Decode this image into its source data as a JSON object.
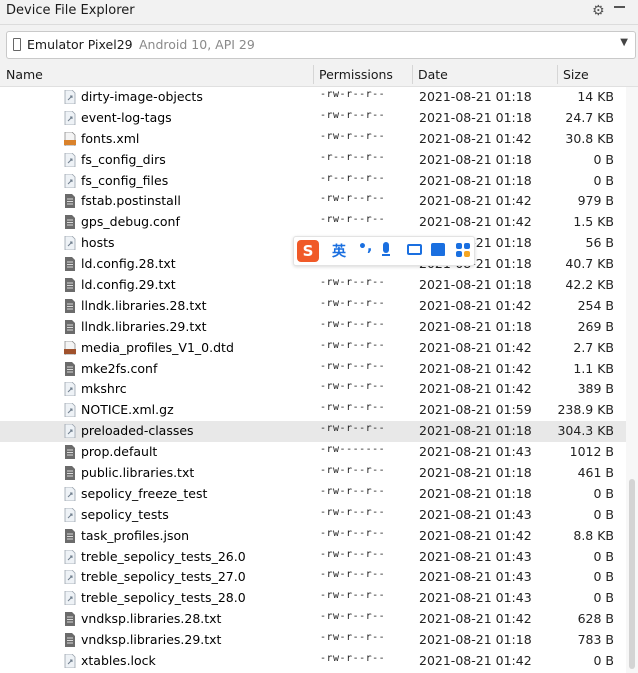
{
  "window": {
    "title": "Device File Explorer",
    "settings_icon": "gear-icon",
    "minimize_icon": "minimize-icon"
  },
  "device": {
    "name": "Emulator Pixel29",
    "detail": "Android 10, API 29"
  },
  "columns": {
    "name": "Name",
    "permissions": "Permissions",
    "date": "Date",
    "size": "Size"
  },
  "ime_toolbar": {
    "logo": "S",
    "lang": "英",
    "punct": "•,",
    "icons": [
      "microphone-icon",
      "keyboard-icon",
      "skin-icon",
      "apps-icon"
    ]
  },
  "files": [
    {
      "name": "dirty-image-objects",
      "perm": "-rw-r--r--",
      "date": "2021-08-21 01:18",
      "size": "14 KB",
      "icon": "file-link-icon"
    },
    {
      "name": "event-log-tags",
      "perm": "-rw-r--r--",
      "date": "2021-08-21 01:18",
      "size": "24.7 KB",
      "icon": "file-link-icon"
    },
    {
      "name": "fonts.xml",
      "perm": "-rw-r--r--",
      "date": "2021-08-21 01:42",
      "size": "30.8 KB",
      "icon": "xml-file-icon"
    },
    {
      "name": "fs_config_dirs",
      "perm": "-r--r--r--",
      "date": "2021-08-21 01:18",
      "size": "0 B",
      "icon": "file-link-icon"
    },
    {
      "name": "fs_config_files",
      "perm": "-r--r--r--",
      "date": "2021-08-21 01:18",
      "size": "0 B",
      "icon": "file-link-icon"
    },
    {
      "name": "fstab.postinstall",
      "perm": "-rw-r--r--",
      "date": "2021-08-21 01:42",
      "size": "979 B",
      "icon": "text-file-icon"
    },
    {
      "name": "gps_debug.conf",
      "perm": "-rw-r--r--",
      "date": "2021-08-21 01:42",
      "size": "1.5 KB",
      "icon": "text-file-icon"
    },
    {
      "name": "hosts",
      "perm": "-rw-r--r--",
      "date": "2021-08-21 01:18",
      "size": "56 B",
      "icon": "file-link-icon"
    },
    {
      "name": "ld.config.28.txt",
      "perm": "-rw-r--r--",
      "date": "2021-08-21 01:18",
      "size": "40.7 KB",
      "icon": "text-file-icon"
    },
    {
      "name": "ld.config.29.txt",
      "perm": "-rw-r--r--",
      "date": "2021-08-21 01:18",
      "size": "42.2 KB",
      "icon": "text-file-icon"
    },
    {
      "name": "llndk.libraries.28.txt",
      "perm": "-rw-r--r--",
      "date": "2021-08-21 01:42",
      "size": "254 B",
      "icon": "text-file-icon"
    },
    {
      "name": "llndk.libraries.29.txt",
      "perm": "-rw-r--r--",
      "date": "2021-08-21 01:18",
      "size": "269 B",
      "icon": "text-file-icon"
    },
    {
      "name": "media_profiles_V1_0.dtd",
      "perm": "-rw-r--r--",
      "date": "2021-08-21 01:42",
      "size": "2.7 KB",
      "icon": "dtd-file-icon"
    },
    {
      "name": "mke2fs.conf",
      "perm": "-rw-r--r--",
      "date": "2021-08-21 01:42",
      "size": "1.1 KB",
      "icon": "text-file-icon"
    },
    {
      "name": "mkshrc",
      "perm": "-rw-r--r--",
      "date": "2021-08-21 01:42",
      "size": "389 B",
      "icon": "file-link-icon"
    },
    {
      "name": "NOTICE.xml.gz",
      "perm": "-rw-r--r--",
      "date": "2021-08-21 01:59",
      "size": "238.9 KB",
      "icon": "file-link-icon"
    },
    {
      "name": "preloaded-classes",
      "perm": "-rw-r--r--",
      "date": "2021-08-21 01:18",
      "size": "304.3 KB",
      "icon": "file-link-icon",
      "selected": true
    },
    {
      "name": "prop.default",
      "perm": "-rw-------",
      "date": "2021-08-21 01:43",
      "size": "1012 B",
      "icon": "text-file-icon"
    },
    {
      "name": "public.libraries.txt",
      "perm": "-rw-r--r--",
      "date": "2021-08-21 01:18",
      "size": "461 B",
      "icon": "text-file-icon"
    },
    {
      "name": "sepolicy_freeze_test",
      "perm": "-rw-r--r--",
      "date": "2021-08-21 01:18",
      "size": "0 B",
      "icon": "file-link-icon"
    },
    {
      "name": "sepolicy_tests",
      "perm": "-rw-r--r--",
      "date": "2021-08-21 01:43",
      "size": "0 B",
      "icon": "file-link-icon"
    },
    {
      "name": "task_profiles.json",
      "perm": "-rw-r--r--",
      "date": "2021-08-21 01:42",
      "size": "8.8 KB",
      "icon": "text-file-icon"
    },
    {
      "name": "treble_sepolicy_tests_26.0",
      "perm": "-rw-r--r--",
      "date": "2021-08-21 01:43",
      "size": "0 B",
      "icon": "file-link-icon"
    },
    {
      "name": "treble_sepolicy_tests_27.0",
      "perm": "-rw-r--r--",
      "date": "2021-08-21 01:43",
      "size": "0 B",
      "icon": "file-link-icon"
    },
    {
      "name": "treble_sepolicy_tests_28.0",
      "perm": "-rw-r--r--",
      "date": "2021-08-21 01:43",
      "size": "0 B",
      "icon": "file-link-icon"
    },
    {
      "name": "vndksp.libraries.28.txt",
      "perm": "-rw-r--r--",
      "date": "2021-08-21 01:42",
      "size": "628 B",
      "icon": "text-file-icon"
    },
    {
      "name": "vndksp.libraries.29.txt",
      "perm": "-rw-r--r--",
      "date": "2021-08-21 01:18",
      "size": "783 B",
      "icon": "text-file-icon"
    },
    {
      "name": "xtables.lock",
      "perm": "-rw-r--r--",
      "date": "2021-08-21 01:42",
      "size": "0 B",
      "icon": "file-link-icon"
    }
  ]
}
